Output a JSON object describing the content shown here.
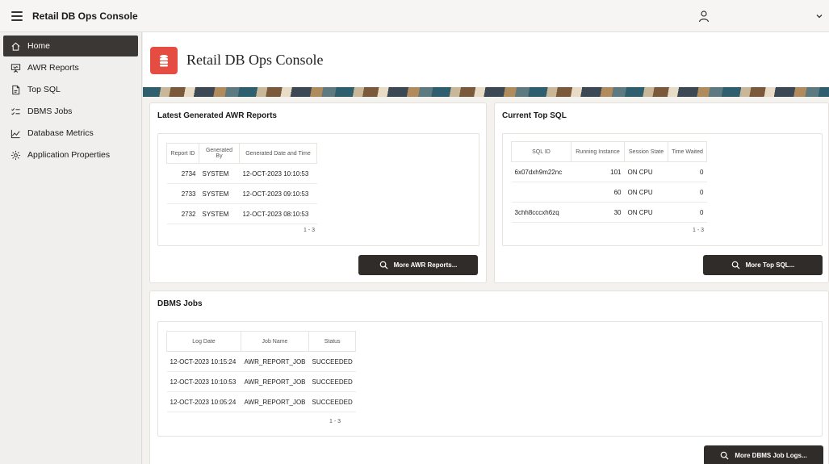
{
  "app": {
    "title": "Retail DB Ops Console"
  },
  "sidebar": {
    "items": [
      {
        "label": "Home",
        "icon": "home-icon",
        "active": true
      },
      {
        "label": "AWR Reports",
        "icon": "presentation-icon"
      },
      {
        "label": "Top SQL",
        "icon": "sql-document-icon"
      },
      {
        "label": "DBMS Jobs",
        "icon": "job-list-icon"
      },
      {
        "label": "Database Metrics",
        "icon": "line-chart-icon"
      },
      {
        "label": "Application Properties",
        "icon": "gear-icon"
      }
    ]
  },
  "hero": {
    "title": "Retail DB Ops Console",
    "icon": "database-icon",
    "accent": "#e64d42"
  },
  "awr": {
    "title": "Latest Generated AWR Reports",
    "columns": [
      "Report ID",
      "Generated By",
      "Generated Date and Time"
    ],
    "rows": [
      [
        "2734",
        "SYSTEM",
        "12-OCT-2023 10:10:53"
      ],
      [
        "2733",
        "SYSTEM",
        "12-OCT-2023 09:10:53"
      ],
      [
        "2732",
        "SYSTEM",
        "12-OCT-2023 08:10:53"
      ]
    ],
    "pagination": "1 - 3",
    "button": "More AWR Reports..."
  },
  "topsql": {
    "title": "Current Top SQL",
    "columns": [
      "SQL ID",
      "Running Instance",
      "Session State",
      "Time Waited"
    ],
    "rows": [
      [
        "6x07dxh9m22nc",
        "101",
        "ON CPU",
        "0"
      ],
      [
        "",
        "60",
        "ON CPU",
        "0"
      ],
      [
        "3chh8cccxh6zq",
        "30",
        "ON CPU",
        "0"
      ]
    ],
    "pagination": "1 - 3",
    "button": "More Top SQL..."
  },
  "jobs": {
    "title": "DBMS Jobs",
    "columns": [
      "Log Date",
      "Job Name",
      "Status"
    ],
    "rows": [
      [
        "12-OCT-2023 10:15:24",
        "AWR_REPORT_JOB",
        "SUCCEEDED"
      ],
      [
        "12-OCT-2023 10:10:53",
        "AWR_REPORT_JOB",
        "SUCCEEDED"
      ],
      [
        "12-OCT-2023 10:05:24",
        "AWR_REPORT_JOB",
        "SUCCEEDED"
      ]
    ],
    "pagination": "1 - 3",
    "button": "More DBMS Job Logs..."
  },
  "header": {
    "user_icon": "user-icon",
    "menu_icon": "chevron-down-icon"
  }
}
